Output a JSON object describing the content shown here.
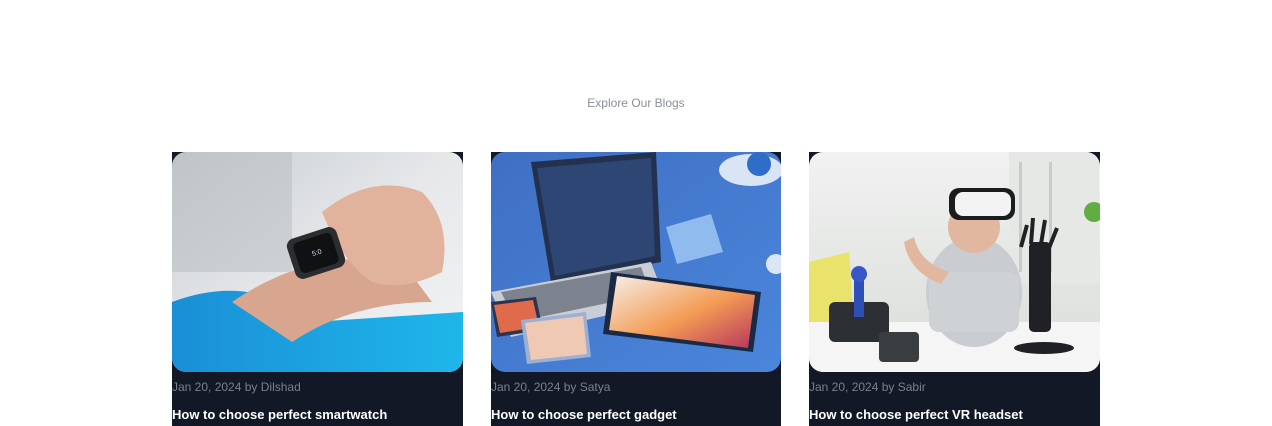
{
  "section": {
    "heading": "Explore Our Blogs"
  },
  "posts": [
    {
      "meta": "Jan 20, 2024 by Dilshad",
      "title": "How to choose perfect smartwatch",
      "image": "smartwatch-photo"
    },
    {
      "meta": "Jan 20, 2024 by Satya",
      "title": "How to choose perfect gadget",
      "image": "gadgets-photo"
    },
    {
      "meta": "Jan 20, 2024 by Sabir",
      "title": "How to choose perfect VR headset",
      "image": "vr-headset-photo"
    }
  ]
}
